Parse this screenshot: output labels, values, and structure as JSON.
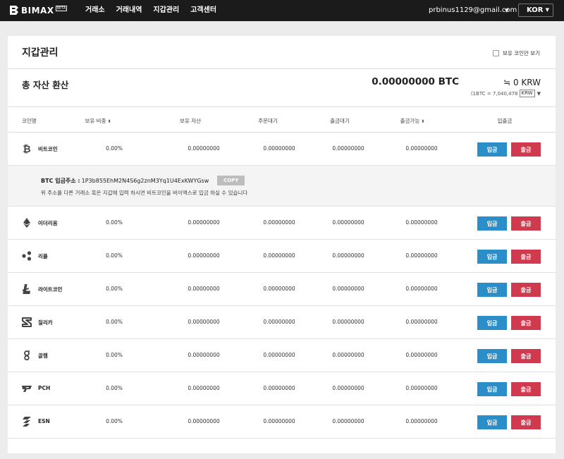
{
  "header": {
    "logo_text": "BIMAX",
    "beta": "BETA",
    "nav": [
      "거래소",
      "거래내역",
      "지갑관리",
      "고객센터"
    ],
    "email": "prbinus1129@gmail.com",
    "language": "KOR"
  },
  "wallet": {
    "title": "지갑관리",
    "holding_only_label": "보유 코인만 보기",
    "total_label": "총 자산 환산",
    "total_btc": "0.00000000 BTC",
    "total_krw": "≒ 0 KRW",
    "rate_text": "(1BTC = 7,040,478",
    "rate_currency": "KRW",
    "columns": [
      "코인명",
      "보유 비중",
      "보유 자산",
      "주문대기",
      "출금대기",
      "출금가능",
      "입출금"
    ],
    "deposit_label": "입금",
    "withdraw_label": "출금",
    "expanded": {
      "address_label": "BTC 입금주소 :",
      "address": "1P3b855EhM2N4S6g2znM3Yq1U4ExKWYGsw",
      "copy_label": "COPY",
      "notice": "위 주소를 다른 거래소 혹은 지갑에 입력 하시면 비트코인을 바이맥스로 입금 하실 수 있습니다"
    },
    "coins": [
      {
        "name": "비트코인",
        "icon": "bitcoin-icon",
        "ratio": "0.00%",
        "holding": "0.00000000",
        "order_wait": "0.00000000",
        "withdraw_wait": "0.00000000",
        "available": "0.00000000"
      },
      {
        "name": "이더리움",
        "icon": "ethereum-icon",
        "ratio": "0.00%",
        "holding": "0.00000000",
        "order_wait": "0.00000000",
        "withdraw_wait": "0.00000000",
        "available": "0.00000000"
      },
      {
        "name": "리플",
        "icon": "ripple-icon",
        "ratio": "0.00%",
        "holding": "0.00000000",
        "order_wait": "0.00000000",
        "withdraw_wait": "0.00000000",
        "available": "0.00000000"
      },
      {
        "name": "라이트코인",
        "icon": "litecoin-icon",
        "ratio": "0.00%",
        "holding": "0.00000000",
        "order_wait": "0.00000000",
        "withdraw_wait": "0.00000000",
        "available": "0.00000000"
      },
      {
        "name": "질리카",
        "icon": "zilliqa-icon",
        "ratio": "0.00%",
        "holding": "0.00000000",
        "order_wait": "0.00000000",
        "withdraw_wait": "0.00000000",
        "available": "0.00000000"
      },
      {
        "name": "골렘",
        "icon": "golem-icon",
        "ratio": "0.00%",
        "holding": "0.00000000",
        "order_wait": "0.00000000",
        "withdraw_wait": "0.00000000",
        "available": "0.00000000"
      },
      {
        "name": "PCH",
        "icon": "pch-icon",
        "ratio": "0.00%",
        "holding": "0.00000000",
        "order_wait": "0.00000000",
        "withdraw_wait": "0.00000000",
        "available": "0.00000000"
      },
      {
        "name": "ESN",
        "icon": "esn-icon",
        "ratio": "0.00%",
        "holding": "0.00000000",
        "order_wait": "0.00000000",
        "withdraw_wait": "0.00000000",
        "available": "0.00000000"
      }
    ]
  }
}
